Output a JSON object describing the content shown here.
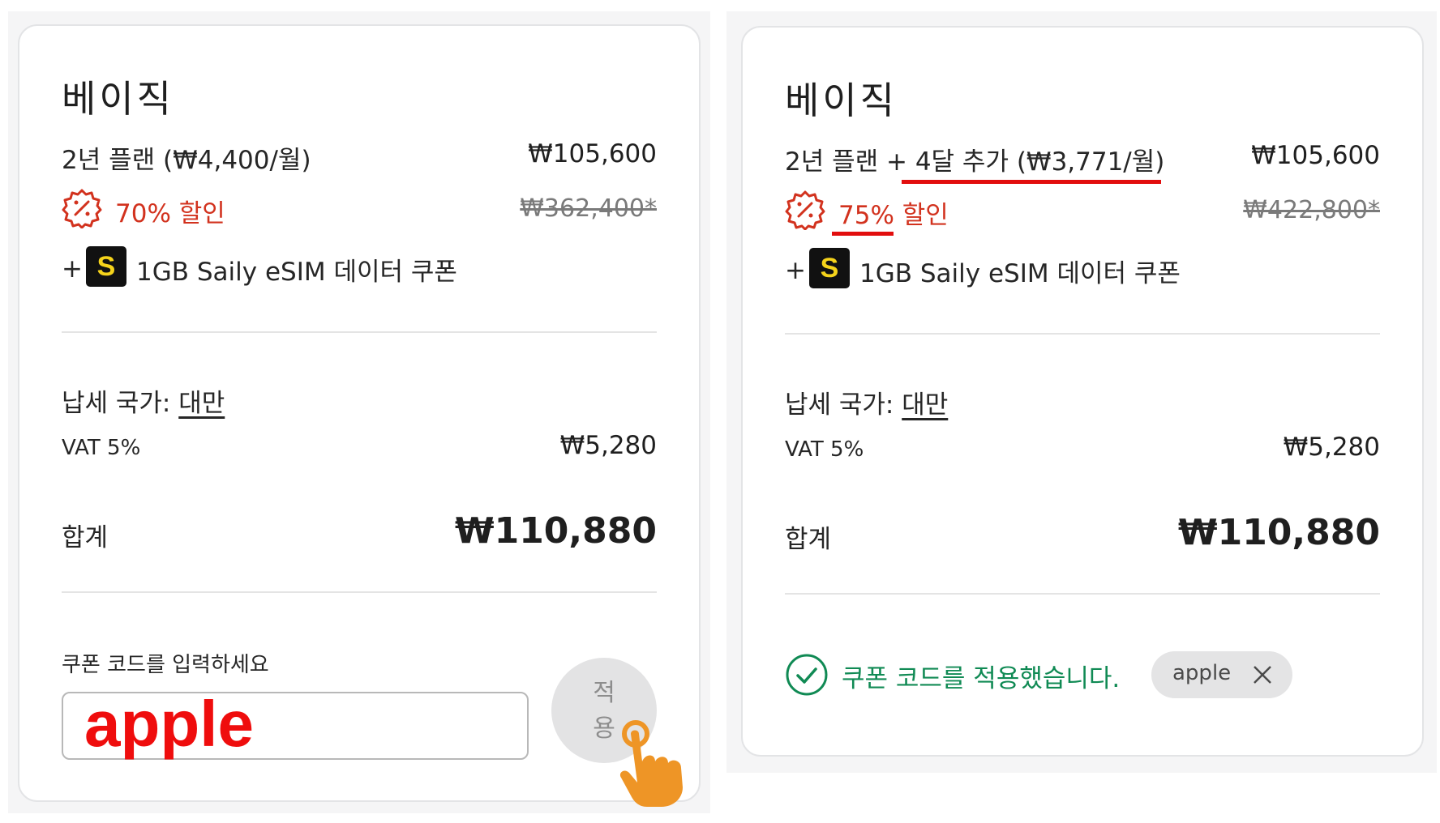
{
  "left": {
    "plan_title": "베이직",
    "plan_line": "2년 플랜 (₩4,400/월)",
    "plan_price": "₩105,600",
    "discount": "70% 할인",
    "original_price": "₩362,400*",
    "coupon_plus": "+",
    "coupon_badge": "S",
    "coupon_text": "1GB Saily eSIM 데이터 쿠폰",
    "tax_label": "납세 국가: ",
    "tax_country": "대만",
    "vat_label": "VAT 5%",
    "vat_amount": "₩5,280",
    "total_label": "합계",
    "total_amount": "₩110,880",
    "coupon_input_label": "쿠폰 코드를 입력하세요",
    "coupon_input_value": "apple",
    "apply_button_line1": "적",
    "apply_button_line2": "용"
  },
  "right": {
    "plan_title": "베이직",
    "plan_line_prefix": "2년 플랜 + ",
    "plan_line_bonus": "4달 추가 (₩3,771/월)",
    "plan_price": "₩105,600",
    "discount_percent": "75%",
    "discount_word": " 할인",
    "original_price": "₩422,800*",
    "coupon_plus": "+",
    "coupon_badge": "S",
    "coupon_text": "1GB Saily eSIM 데이터 쿠폰",
    "tax_label": "납세 국가: ",
    "tax_country": "대만",
    "vat_label": "VAT 5%",
    "vat_amount": "₩5,280",
    "total_label": "합계",
    "total_amount": "₩110,880",
    "coupon_applied_text": "쿠폰 코드를 적용했습니다.",
    "coupon_chip_value": "apple"
  },
  "colors": {
    "discount_red": "#d2321e",
    "annotation_red": "#e20e0e",
    "success_green": "#108a54",
    "hand_orange": "#ee9526",
    "badge_yellow": "#f5d31b"
  },
  "icons": {
    "discount": "discount-badge-icon",
    "success": "check-circle-icon",
    "chip_close": "close-icon",
    "pointer": "tap-hand-icon"
  }
}
